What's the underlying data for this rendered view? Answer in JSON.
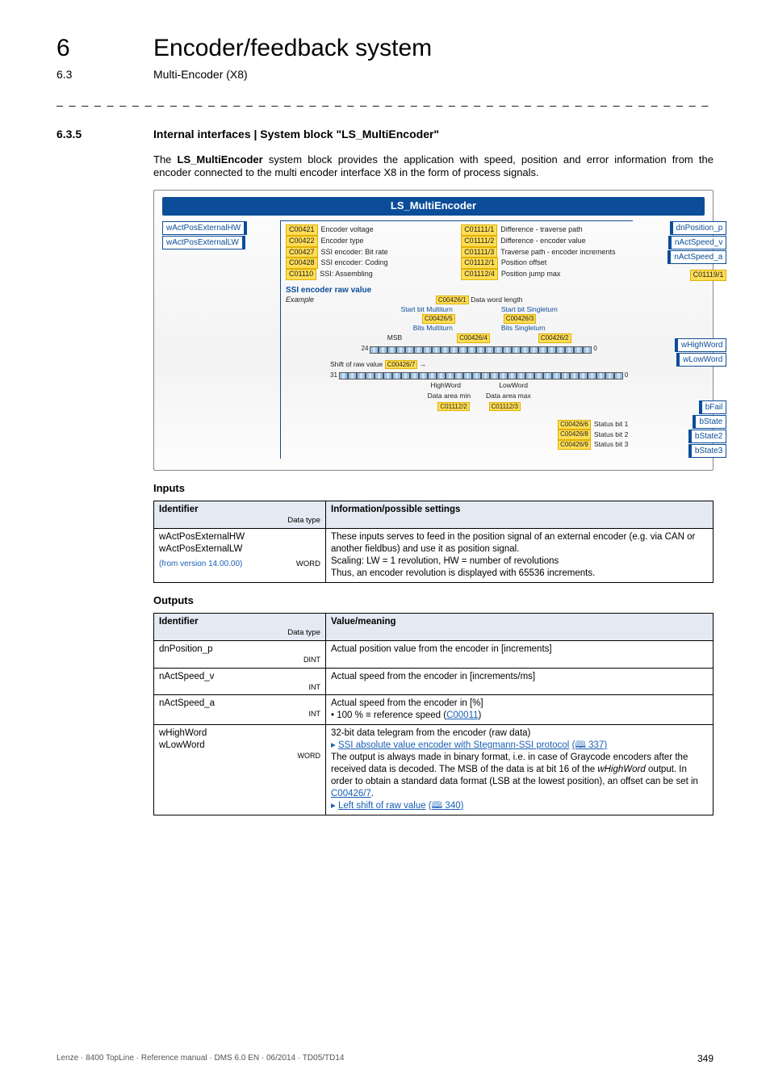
{
  "chapter": {
    "num": "6",
    "title": "Encoder/feedback system"
  },
  "section_top": {
    "num": "6.3",
    "title": "Multi-Encoder (X8)"
  },
  "section": {
    "num": "6.3.5",
    "title": "Internal interfaces | System block \"LS_MultiEncoder\""
  },
  "intro": "The LS_MultiEncoder system block provides the application with speed, position and error information from the encoder connected to the multi encoder interface X8 in the form of process signals.",
  "diagram": {
    "title": "LS_MultiEncoder",
    "inputs_ports": [
      {
        "name": "wActPosExternalHW"
      },
      {
        "name": "wActPosExternalLW"
      }
    ],
    "params_left": [
      {
        "code": "C00421",
        "label": "Encoder voltage"
      },
      {
        "code": "C00422",
        "label": "Encoder type"
      },
      {
        "code": "C00427",
        "label": "SSI encoder: Bit rate"
      },
      {
        "code": "C00428",
        "label": "SSI encoder: Coding"
      },
      {
        "code": "C01110",
        "label": "SSI: Assembling"
      }
    ],
    "params_right": [
      {
        "code": "C01111/1",
        "label": "Difference - traverse path"
      },
      {
        "code": "C01111/2",
        "label": "Difference - encoder value"
      },
      {
        "code": "C01111/3",
        "label": "Traverse path - encoder increments"
      },
      {
        "code": "C01112/1",
        "label": "Position offset"
      },
      {
        "code": "C01112/4",
        "label": "Position jump max"
      }
    ],
    "ssi_header": "SSI encoder raw value",
    "example_label": "Example",
    "data_word_length": {
      "code": "C00426/1",
      "label": "Data word length"
    },
    "multiturn": {
      "start_label": "Start bit Multiturn",
      "start_code": "C00426/5",
      "bits_label": "Bits Multiturn",
      "bits_code": "C00426/4"
    },
    "singleturn": {
      "start_label": "Start bit Singleturn",
      "start_code": "C00426/3",
      "bits_label": "Bits Singleturn",
      "bits_code": "C00426/2"
    },
    "msb_label": "MSB",
    "bit24": "24",
    "shift_label": "Shift of raw value",
    "shift_code": "C00426/7",
    "bit31": "31",
    "high_word": "HighWord",
    "low_word": "LowWord",
    "data_area_min": {
      "label": "Data area min",
      "code": "C01112/2"
    },
    "data_area_max": {
      "label": "Data area max",
      "code": "C01112/3"
    },
    "status_bits": [
      {
        "code": "C00426/6",
        "label": "Status bit 1"
      },
      {
        "code": "C00426/8",
        "label": "Status bit 2"
      },
      {
        "code": "C00426/9",
        "label": "Status bit 3"
      }
    ],
    "outputs_ports_top": [
      {
        "name": "dnPosition_p"
      },
      {
        "name": "nActSpeed_v"
      },
      {
        "name": "nActSpeed_a"
      }
    ],
    "c01119": "C01119/1",
    "outputs_ports_mid": [
      {
        "name": "wHighWord"
      },
      {
        "name": "wLowWord"
      }
    ],
    "outputs_ports_bot": [
      {
        "name": "bFail"
      },
      {
        "name": "bState"
      },
      {
        "name": "bState2"
      },
      {
        "name": "bState3"
      }
    ]
  },
  "inputs_heading": "Inputs",
  "outputs_heading": "Outputs",
  "hdr_identifier": "Identifier",
  "hdr_datatype": "Data type",
  "hdr_info": "Information/possible settings",
  "hdr_value": "Value/meaning",
  "inputs_table": {
    "row1": {
      "id1": "wActPosExternalHW",
      "id2": "wActPosExternalLW",
      "version": "(from version 14.00.00)",
      "dtype": "WORD",
      "desc_line1": "These inputs serves to feed in the position signal of an external encoder (e.g. via CAN or another fieldbus) and use it as position signal.",
      "desc_line2": "Scaling: LW = 1 revolution, HW = number of revolutions",
      "desc_line3": "Thus, an encoder revolution is displayed with 65536 increments."
    }
  },
  "outputs_table": {
    "row1": {
      "id": "dnPosition_p",
      "dtype": "DINT",
      "desc": "Actual position value from the encoder in [increments]"
    },
    "row2": {
      "id": "nActSpeed_v",
      "dtype": "INT",
      "desc": "Actual speed from the encoder in [increments/ms]"
    },
    "row3": {
      "id": "nActSpeed_a",
      "dtype": "INT",
      "desc_line1": "Actual speed from the encoder in [%]",
      "bullet_prefix": "• 100 % ≡ reference speed (",
      "bullet_link": "C00011",
      "bullet_suffix": ")"
    },
    "row4": {
      "id1": "wHighWord",
      "id2": "wLowWord",
      "dtype": "WORD",
      "line1": "32-bit data telegram from the encoder (raw data)",
      "link1_text": "SSI absolute value encoder with Stegmann-SSI protocol",
      "link1_page": "(🕮 337)",
      "line3_a": "The output is always made in binary format, i.e. in case of Graycode encoders after the received data is decoded. The MSB of the data is at bit 16 of the ",
      "line3_em": "wHighWord",
      "line3_b": " output. In order to obtain a standard data format (LSB at the lowest position), an offset can be set in ",
      "line3_link": "C00426/7",
      "line3_end": ".",
      "link2_text": "Left shift of raw value",
      "link2_page": "(🕮 340)"
    }
  },
  "footer": {
    "left": "Lenze · 8400 TopLine · Reference manual · DMS 6.0 EN · 06/2014 · TD05/TD14",
    "page": "349"
  }
}
